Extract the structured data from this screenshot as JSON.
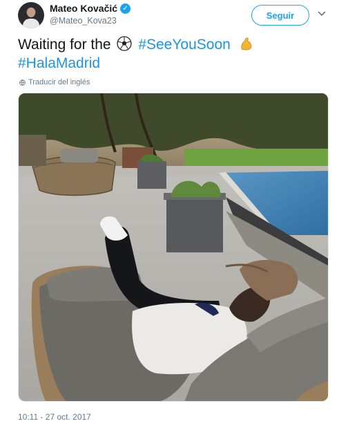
{
  "user": {
    "display_name": "Mateo Kovačić",
    "handle": "@Mateo_Kova23",
    "verified": true
  },
  "follow_button": {
    "label": "Seguir"
  },
  "tweet": {
    "text_before": "Waiting for the",
    "hashtag_1": "#SeeYouSoon",
    "hashtag_2": "#HalaMadrid",
    "translate_label": "Traducir del inglés",
    "timestamp": "10:11 - 27 oct. 2017"
  },
  "icons": {
    "verified": "verified-badge-icon",
    "chevron": "chevron-down-icon",
    "globe": "globe-icon",
    "emoji_1": "soccer-ball-emoji",
    "emoji_2": "flexed-biceps-emoji"
  },
  "colors": {
    "accent": "#1da1f2",
    "hashtag": "#1b95e0",
    "muted": "#657786"
  }
}
